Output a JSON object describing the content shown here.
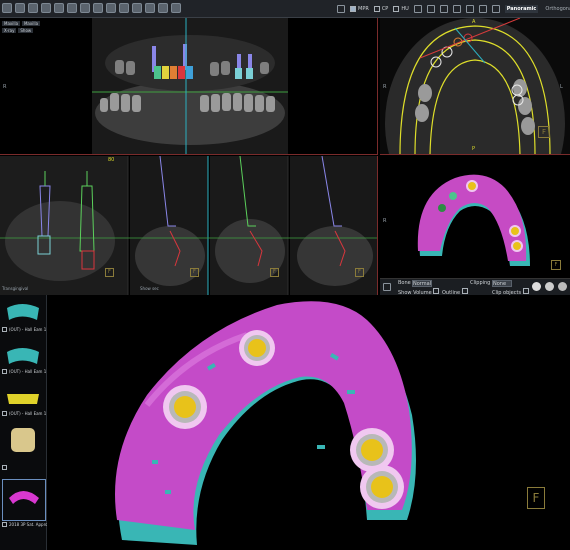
{
  "toolbar": {
    "options": [
      {
        "label": "MPR",
        "checked": true
      },
      {
        "label": "CP",
        "checked": false
      },
      {
        "label": "HU",
        "checked": false
      }
    ],
    "tabs": [
      "Panoramic",
      "Orthogonal"
    ],
    "active_tab": "Panoramic"
  },
  "views": {
    "axial_tabs": [
      "Maxilla",
      "Maxilla"
    ],
    "axial_sub": [
      "X-ray",
      "Show"
    ],
    "left_mark": "R",
    "top_mark": "H",
    "right_axial_marks": {
      "top": "A",
      "left": "R",
      "right": "L",
      "bottom": "P"
    },
    "right_r": "R",
    "cross_number": "80",
    "cross_bottom_left": "Transgingival",
    "bottom_small_tab": "Show sec"
  },
  "render3d": {
    "bone_label": "Bone",
    "bone_select": "Normal",
    "clipping_label": "Clipping",
    "clipping_select": "None",
    "show_volume": "Show Volume",
    "outline": "Outline",
    "clip_objects": "Clip objects"
  },
  "thumbnails": [
    {
      "label": "(OUT) - Hall Eam 1",
      "color": "#39b6b5"
    },
    {
      "label": "(OUT) - Hall Eam 1",
      "color": "#39b6b5"
    },
    {
      "label": "(OUT) - Hall Eam 1",
      "color": "#e0d22a"
    },
    {
      "label": "",
      "color": "#d9c78c"
    },
    {
      "label": "2018 3P Sat. Approve",
      "color": "#d838d0"
    }
  ],
  "colors": {
    "guide": "#d838d0",
    "teal": "#39b6b5",
    "sleeve": "#e8c21a",
    "ring": "#f0c8f0"
  }
}
